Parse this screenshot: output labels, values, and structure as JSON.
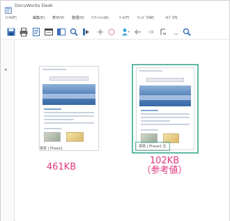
{
  "window": {
    "title": "DocuWorks Desk"
  },
  "menu": {
    "items": [
      {
        "name": "menu-file",
        "label": "ﾌｧｲﾙ(F)"
      },
      {
        "name": "menu-edit",
        "label": "編集(E)"
      },
      {
        "name": "menu-view",
        "label": "表示(V)"
      },
      {
        "name": "menu-organize",
        "label": "整理(O)"
      },
      {
        "name": "menu-annotate",
        "label": "ｱﾉﾃｰｼｮﾝ(A)"
      },
      {
        "name": "menu-tools",
        "label": "ﾂｰﾙ(T)"
      },
      {
        "name": "menu-window",
        "label": "ｳｨﾝﾄﾞｳ(W)"
      },
      {
        "name": "menu-help",
        "label": "ﾍﾙﾌﾟ(H)"
      }
    ]
  },
  "toolbar": {
    "buttons": [
      "save-icon",
      "print-icon",
      "page-icon",
      "page-view-icon",
      "layout-icon",
      "zoom-icon",
      "insert-icon",
      "add-icon",
      "undo-icon",
      "user-icon",
      "back-icon",
      "forward-icon",
      "annotation-icon",
      "search-icon"
    ]
  },
  "thumbnails": [
    {
      "label": "標準 | Phase1",
      "size_note_line1": "461KB",
      "size_note_line2": ""
    },
    {
      "label": "標準 | Phase1 圧",
      "size_note_line1": "102KB",
      "size_note_line2": "（参考値）"
    }
  ],
  "colors": {
    "accent": "#5fb8a3",
    "note": "#e0357e"
  }
}
